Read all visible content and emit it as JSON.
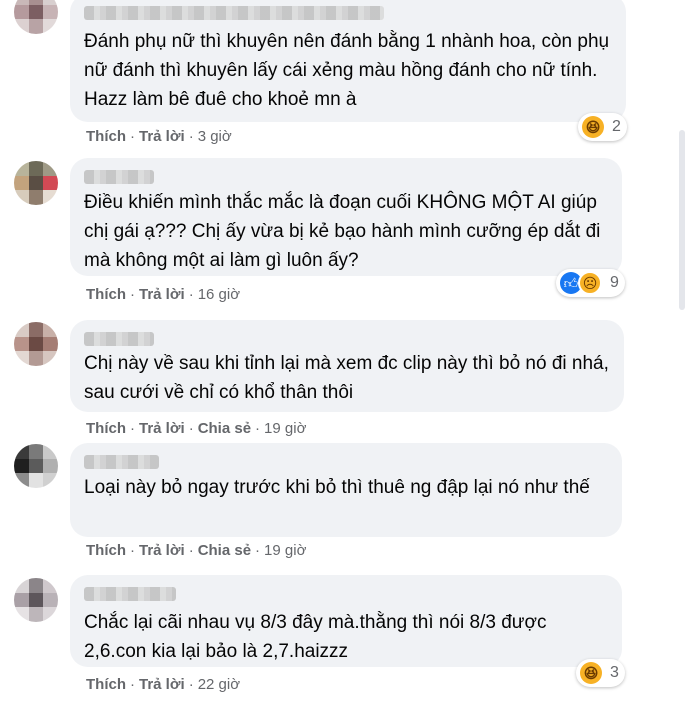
{
  "comments": [
    {
      "text": "Đánh phụ nữ thì khuyên nên đánh bằng 1 nhành hoa, còn phụ nữ đánh thì khuyên lấy cái xẻng màu hồng đánh cho nữ tính. Hazz làm bê đuê cho khoẻ mn à",
      "like": "Thích",
      "reply": "Trả lời",
      "share": "",
      "time": "3 giờ",
      "reactions": {
        "types": [
          "haha-icon"
        ],
        "count": "2"
      }
    },
    {
      "text": "Điều khiến mình thắc mắc là đoạn cuối KHÔNG MỘT AI giúp chị gái ạ??? Chị ấy vừa bị kẻ bạo hành mình cưỡng ép dắt đi mà không một ai làm gì luôn ấy?",
      "like": "Thích",
      "reply": "Trả lời",
      "share": "",
      "time": "16 giờ",
      "reactions": {
        "types": [
          "like-icon",
          "sad-icon"
        ],
        "count": "9"
      }
    },
    {
      "text": "Chị này về sau khi tỉnh lại mà xem đc clip này thì bỏ nó đi nhá, sau cưới về chỉ có khổ thân thôi",
      "like": "Thích",
      "reply": "Trả lời",
      "share": "Chia sẻ",
      "time": "19 giờ",
      "reactions": null
    },
    {
      "text": "Loại này bỏ ngay trước khi bỏ thì thuê ng đập lại nó như thế",
      "like": "Thích",
      "reply": "Trả lời",
      "share": "Chia sẻ",
      "time": "19 giờ",
      "reactions": null
    },
    {
      "text": "Chắc lại cãi nhau vụ 8/3 đây mà.thằng thì nói 8/3 được 2,6.con kia lại bảo là 2,7.haizzz",
      "like": "Thích",
      "reply": "Trả lời",
      "share": "",
      "time": "22 giờ",
      "reactions": {
        "types": [
          "haha-icon"
        ],
        "count": "3"
      }
    }
  ],
  "colors": {
    "bubble": "#f0f2f5",
    "meta": "#65676b",
    "like_blue": "#1877f2",
    "haha_yellow": "#f7b125"
  }
}
